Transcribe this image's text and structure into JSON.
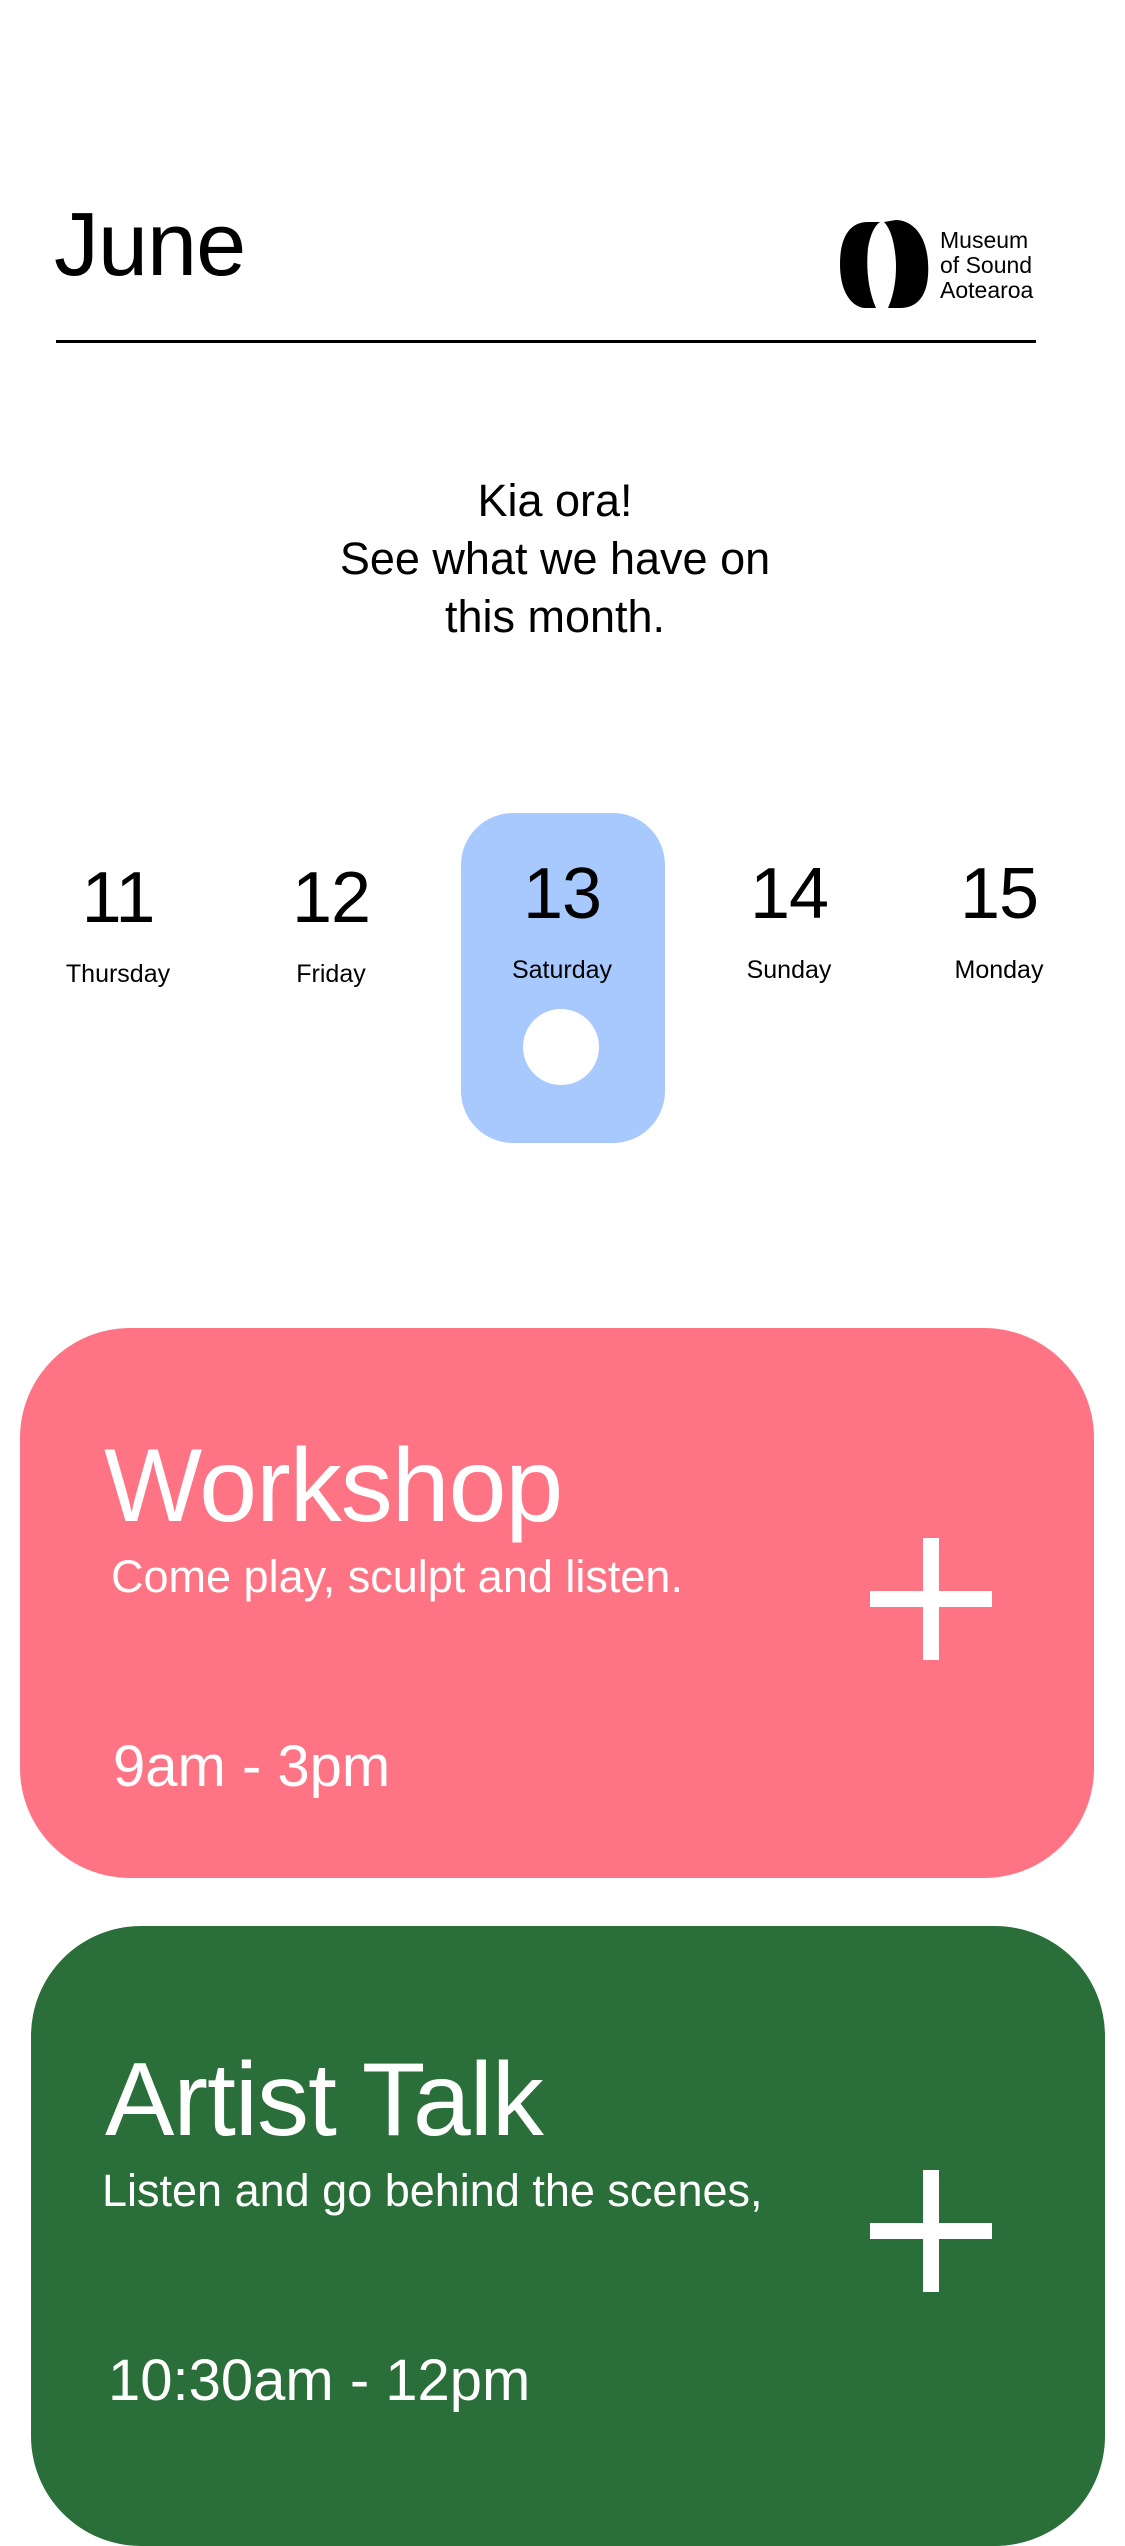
{
  "header": {
    "month": "June",
    "logo": {
      "lines": [
        "Museum",
        "of Sound",
        "Aotearoa"
      ],
      "icon": "museum-logo-mark-icon"
    }
  },
  "greeting": {
    "lines": [
      "Kia ora!",
      "See what we have on",
      "this month."
    ]
  },
  "days": [
    {
      "number": "11",
      "name": "Thursday",
      "selected": false
    },
    {
      "number": "12",
      "name": "Friday",
      "selected": false
    },
    {
      "number": "13",
      "name": "Saturday",
      "selected": true
    },
    {
      "number": "14",
      "name": "Sunday",
      "selected": false
    },
    {
      "number": "15",
      "name": "Monday",
      "selected": false
    }
  ],
  "events": [
    {
      "title": "Workshop",
      "description": "Come play, sculpt and listen.",
      "time": "9am - 3pm",
      "color": "#fe7484",
      "action_icon": "plus-icon"
    },
    {
      "title": "Artist Talk",
      "description": "Listen and go behind the scenes,",
      "time": "10:30am - 12pm",
      "color": "#2a6f3a",
      "action_icon": "plus-icon"
    }
  ],
  "colors": {
    "selected_day": "#a8c9fd",
    "text": "#000000",
    "card_text": "#ffffff"
  }
}
